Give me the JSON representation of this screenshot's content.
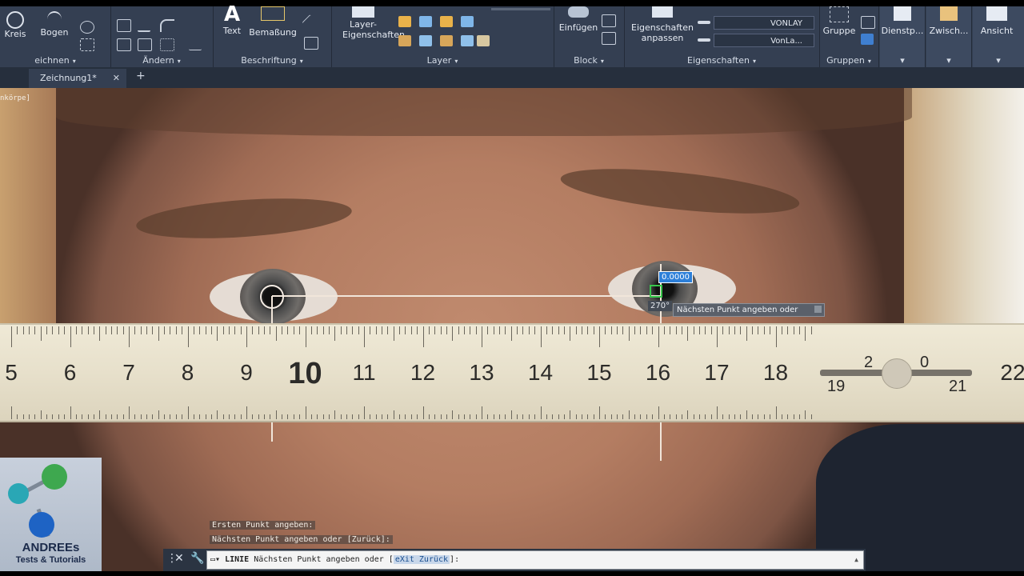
{
  "ribbon": {
    "panels": [
      {
        "title": "eichnen",
        "tools": [
          "Kreis",
          "Bogen"
        ]
      },
      {
        "title": "Ändern"
      },
      {
        "title": "Beschriftung",
        "tools": [
          "Text",
          "Bemaßung"
        ]
      },
      {
        "title": "Layer",
        "tools": [
          "Layer-Eigenschaften"
        ]
      },
      {
        "title": "Block",
        "tools": [
          "Einfügen"
        ]
      },
      {
        "title": "Eigenschaften",
        "tools": [
          "Eigenschaften anpassen"
        ],
        "dropdowns": [
          "VONLAY",
          "VonLa..."
        ]
      },
      {
        "title": "Gruppen",
        "tools": [
          "Gruppe"
        ]
      },
      {
        "tools": [
          "Dienstp...",
          "Zwisch...",
          "Ansicht"
        ]
      }
    ]
  },
  "tabs": {
    "active": "Zeichnung1*"
  },
  "canvas": {
    "viewport_label": "nkörpe]",
    "dimension_value": "0.0000",
    "angle_value": "270°",
    "tooltip": "Nächsten Punkt angeben oder"
  },
  "ruler": {
    "numbers": [
      "5",
      "6",
      "7",
      "8",
      "9",
      "10",
      "11",
      "12",
      "13",
      "14",
      "15",
      "16",
      "17",
      "18"
    ],
    "right_labels": [
      "2",
      "0",
      "19",
      "21",
      "22"
    ]
  },
  "command": {
    "history": [
      "Ersten Punkt angeben:",
      "Nächsten Punkt angeben oder [Zurück]:"
    ],
    "keyword": "LINIE",
    "prompt": "Nächsten Punkt angeben oder [",
    "option": "eXit Zurück",
    "suffix": "]:"
  },
  "logo": {
    "line1": "ANDREEs",
    "line2": "Tests & Tutorials"
  },
  "colors": {
    "ribbon": "#343f52",
    "accent": "#2d7fd8",
    "snap": "#39c54c"
  }
}
